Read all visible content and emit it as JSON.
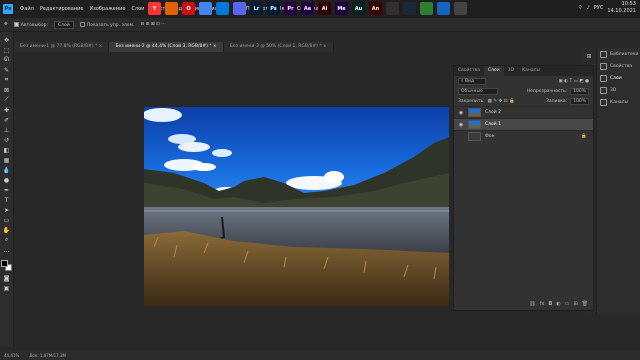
{
  "app": {
    "logo": "Ps"
  },
  "menu": [
    "Файл",
    "Редактирование",
    "Изображение",
    "Слои",
    "Текст",
    "Выделение",
    "Фильтр",
    "3D",
    "Просмотр",
    "Окно",
    "Справка"
  ],
  "taskbar_icons": [
    {
      "name": "yandex-browser-icon",
      "label": "Y",
      "color": "#f33"
    },
    {
      "name": "firefox-icon",
      "label": "",
      "color": "#e66000"
    },
    {
      "name": "opera-icon",
      "label": "O",
      "color": "#cc0f16"
    },
    {
      "name": "chrome-icon",
      "label": "",
      "color": "#4285f4"
    },
    {
      "name": "mail-icon",
      "label": "",
      "color": "#0078d7"
    },
    {
      "name": "discord-icon",
      "label": "",
      "color": "#5865f2"
    },
    {
      "name": "lr-icon",
      "label": "Lr",
      "color": "#001e36"
    },
    {
      "name": "ps-icon",
      "label": "Ps",
      "color": "#001e36"
    },
    {
      "name": "pr-icon",
      "label": "Pr",
      "color": "#2a0047"
    },
    {
      "name": "ae-icon",
      "label": "Ae",
      "color": "#1f0040"
    },
    {
      "name": "ai-icon",
      "label": "Ai",
      "color": "#330000"
    },
    {
      "name": "me-icon",
      "label": "Me",
      "color": "#1f0040"
    },
    {
      "name": "au-icon",
      "label": "Au",
      "color": "#00231f"
    },
    {
      "name": "an-icon",
      "label": "An",
      "color": "#3a0000"
    },
    {
      "name": "obs-icon",
      "label": "",
      "color": "#302e31"
    },
    {
      "name": "steam-icon",
      "label": "",
      "color": "#1b2838"
    },
    {
      "name": "app-green-icon",
      "label": "",
      "color": "#2e7d32"
    },
    {
      "name": "app-blue-icon",
      "label": "",
      "color": "#1565c0"
    },
    {
      "name": "settings-gear-icon",
      "label": "",
      "color": "#444"
    }
  ],
  "tray": {
    "lang": "РУС",
    "time": "10:53",
    "date": "14.10.2021"
  },
  "options": {
    "autoselect": "Автовыбор:",
    "autoselect_value": "Слой",
    "transform": "Показать упр. элем."
  },
  "tabs": [
    {
      "label": "Без имени-1 @ 77,8% (RGB/8#) *",
      "active": false
    },
    {
      "label": "Без имени-2 @ 44,4% (Слой 3, RGB/8#) *",
      "active": true
    },
    {
      "label": "Без имени-3 @ 50% (Слой 1, RGB/8#) *",
      "active": false
    }
  ],
  "panel": {
    "tabs": [
      "Свойства",
      "Слои",
      "3D",
      "Каналы"
    ],
    "active_tab": "Слои",
    "kind": "Вид",
    "blend": "Обычные",
    "opacity_label": "Непрозрачность:",
    "opacity": "100%",
    "lock_label": "Закрепить:",
    "fill_label": "Заливка:",
    "fill": "100%",
    "layers": [
      {
        "name": "Слой 2",
        "selected": false,
        "visible": true,
        "thumb": "sky"
      },
      {
        "name": "Слой 1",
        "selected": true,
        "visible": true,
        "thumb": "sky"
      },
      {
        "name": "Фон",
        "selected": false,
        "visible": false,
        "thumb": "dark"
      }
    ]
  },
  "dock": [
    "Библиотеки",
    "Свойства",
    "Слои",
    "3D",
    "Каналы"
  ],
  "status": {
    "zoom": "44,41%",
    "doc": "Док: 1,87М/17,3М"
  }
}
